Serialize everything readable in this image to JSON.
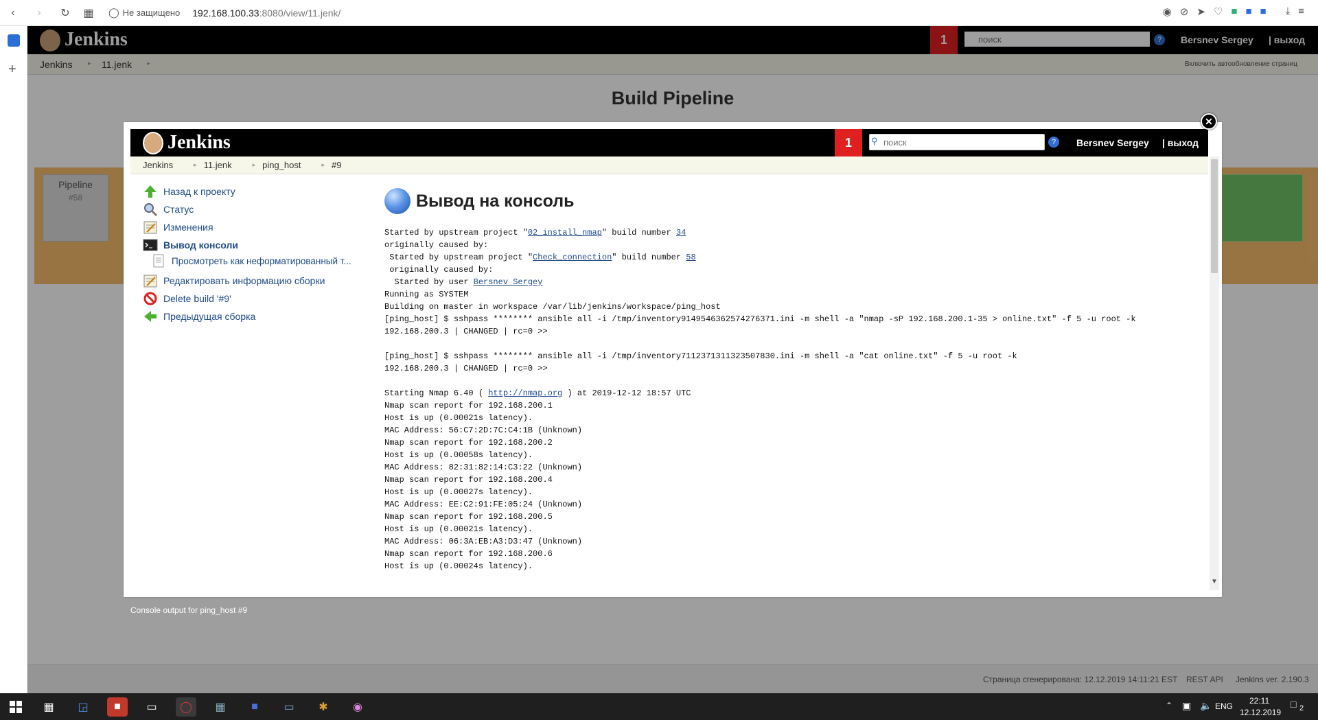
{
  "browser": {
    "security": "Не защищено",
    "url_host": "192.168.100.33",
    "url_rest": ":8080/view/11.jenk/"
  },
  "bg": {
    "logo": "Jenkins",
    "badge": "1",
    "search_placeholder": "поиск",
    "user": "Bersnev Sergey",
    "logout": "| выход",
    "breadcrumbs": [
      "Jenkins",
      "11.jenk"
    ],
    "auto_refresh": "Включить автообновление страниц",
    "title": "Build Pipeline",
    "pipeline_label": "Pipeline",
    "pipeline_num": "#58",
    "caption": "Console output for ping_host #9",
    "footer_generated": "Страница сгенерирована: 12.12.2019 14:11:21 EST",
    "footer_rest": "REST API",
    "footer_version": "Jenkins ver. 2.190.3"
  },
  "modal": {
    "logo": "Jenkins",
    "badge": "1",
    "search_placeholder": "поиск",
    "user": "Bersnev Sergey",
    "logout": "| выход",
    "breadcrumbs": [
      "Jenkins",
      "11.jenk",
      "ping_host",
      "#9"
    ],
    "tasks": [
      {
        "label": "Назад к проекту",
        "icon": "up-arrow-icon"
      },
      {
        "label": "Статус",
        "icon": "magnifier-icon"
      },
      {
        "label": "Изменения",
        "icon": "notepad-icon"
      },
      {
        "label": "Вывод консоли",
        "icon": "terminal-icon"
      },
      {
        "label": "Просмотреть как неформатированный т...",
        "icon": "document-icon"
      },
      {
        "label": "Редактировать информацию сборки",
        "icon": "notepad-icon"
      },
      {
        "label": "Delete build '#9'",
        "icon": "no-entry-icon"
      },
      {
        "label": "Предыдущая сборка",
        "icon": "left-arrow-icon"
      }
    ],
    "heading": "Вывод на консоль",
    "console": {
      "l1a": "Started by upstream project \"",
      "l1_link": "02_install_nmap",
      "l1b": "\" build number ",
      "l1_num": "34",
      "l2": "originally caused by:",
      "l3a": " Started by upstream project \"",
      "l3_link": "Check_connection",
      "l3b": "\" build number ",
      "l3_num": "58",
      "l4": " originally caused by:",
      "l5a": "  Started by user ",
      "l5_link": "Bersnev Sergey",
      "l6": "Running as SYSTEM",
      "l7": "Building on master in workspace /var/lib/jenkins/workspace/ping_host",
      "l8": "[ping_host] $ sshpass ******** ansible all -i /tmp/inventory9149546362574276371.ini -m shell -a \"nmap -sP 192.168.200.1-35 > online.txt\" -f 5 -u root -k",
      "l9": "192.168.200.3 | CHANGED | rc=0 >>",
      "l10": "",
      "l11": "[ping_host] $ sshpass ******** ansible all -i /tmp/inventory7112371311323507830.ini -m shell -a \"cat online.txt\" -f 5 -u root -k",
      "l12": "192.168.200.3 | CHANGED | rc=0 >>",
      "l13": "",
      "l14a": "Starting Nmap 6.40 ( ",
      "l14_link": "http://nmap.org",
      "l14b": " ) at 2019-12-12 18:57 UTC",
      "l15": "Nmap scan report for 192.168.200.1",
      "l16": "Host is up (0.00021s latency).",
      "l17": "MAC Address: 56:C7:2D:7C:C4:1B (Unknown)",
      "l18": "Nmap scan report for 192.168.200.2",
      "l19": "Host is up (0.00058s latency).",
      "l20": "MAC Address: 82:31:82:14:C3:22 (Unknown)",
      "l21": "Nmap scan report for 192.168.200.4",
      "l22": "Host is up (0.00027s latency).",
      "l23": "MAC Address: EE:C2:91:FE:05:24 (Unknown)",
      "l24": "Nmap scan report for 192.168.200.5",
      "l25": "Host is up (0.00021s latency).",
      "l26": "MAC Address: 06:3A:EB:A3:D3:47 (Unknown)",
      "l27": "Nmap scan report for 192.168.200.6",
      "l28": "Host is up (0.00024s latency)."
    }
  },
  "taskbar": {
    "lang": "ENG",
    "time": "22:11",
    "date": "12.12.2019",
    "notif": "2"
  }
}
